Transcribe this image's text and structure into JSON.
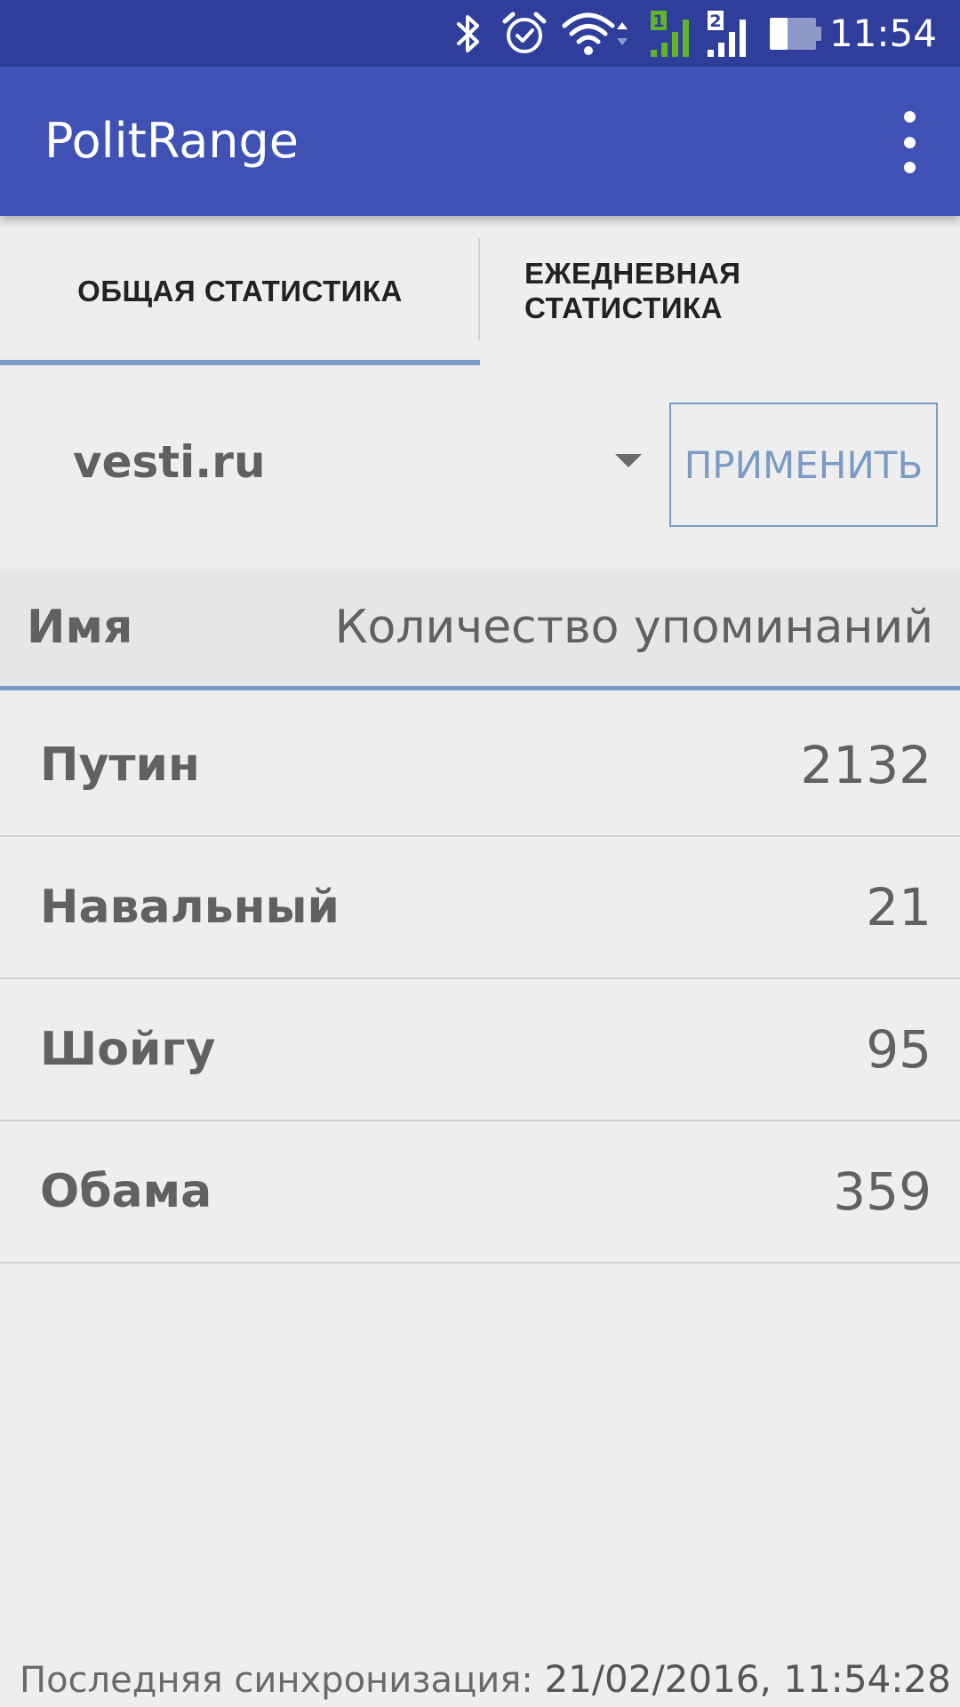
{
  "status_bar": {
    "time": "11:54",
    "sim1_label": "1",
    "sim2_label": "2",
    "icons": [
      "bluetooth-icon",
      "alarm-icon",
      "wifi-icon",
      "signal-sim1-icon",
      "signal-sim2-icon",
      "battery-icon"
    ],
    "battery_level": 0.4
  },
  "app_bar": {
    "title": "PolitRange",
    "menu_icon": "more-vert-icon"
  },
  "tabs": [
    {
      "label": "ОБЩАЯ СТАТИСТИКА",
      "selected": true
    },
    {
      "label": "ЕЖЕДНЕВНАЯ СТАТИСТИКА",
      "selected": false
    }
  ],
  "controls": {
    "source_selected": "vesti.ru",
    "apply_label": "ПРИМЕНИТЬ"
  },
  "table": {
    "headers": {
      "name": "Имя",
      "count": "Количество упоминаний"
    },
    "rows": [
      {
        "name": "Путин",
        "count": "2132"
      },
      {
        "name": "Навальный",
        "count": "21"
      },
      {
        "name": "Шойгу",
        "count": "95"
      },
      {
        "name": "Обама",
        "count": "359"
      }
    ]
  },
  "footer": {
    "sync_label": "Последняя синхронизация:",
    "sync_value": "21/02/2016, 11:54:28"
  },
  "colors": {
    "status_bar": "#2f3e9b",
    "app_bar": "#3f51b5",
    "accent": "#7b9bc4",
    "signal_sim1": "#5fb42b"
  }
}
